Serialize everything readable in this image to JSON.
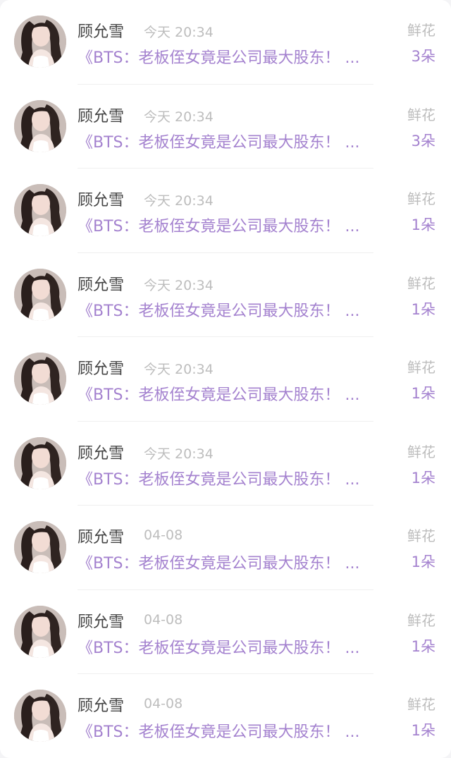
{
  "notifications": [
    {
      "name": "顾允雪",
      "time": "今天 20:34",
      "gift_label": "鲜花",
      "message": "《BTS：老板侄女竟是公司最大股东！ ...",
      "count": "3朵",
      "avatar_icon": "user-avatar-photo"
    },
    {
      "name": "顾允雪",
      "time": "今天 20:34",
      "gift_label": "鲜花",
      "message": "《BTS：老板侄女竟是公司最大股东！ ...",
      "count": "3朵",
      "avatar_icon": "user-avatar-photo"
    },
    {
      "name": "顾允雪",
      "time": "今天 20:34",
      "gift_label": "鲜花",
      "message": "《BTS：老板侄女竟是公司最大股东！ ...",
      "count": "1朵",
      "avatar_icon": "user-avatar-photo"
    },
    {
      "name": "顾允雪",
      "time": "今天 20:34",
      "gift_label": "鲜花",
      "message": "《BTS：老板侄女竟是公司最大股东！ ...",
      "count": "1朵",
      "avatar_icon": "user-avatar-photo"
    },
    {
      "name": "顾允雪",
      "time": "今天 20:34",
      "gift_label": "鲜花",
      "message": "《BTS：老板侄女竟是公司最大股东！ ...",
      "count": "1朵",
      "avatar_icon": "user-avatar-photo"
    },
    {
      "name": "顾允雪",
      "time": "今天 20:34",
      "gift_label": "鲜花",
      "message": "《BTS：老板侄女竟是公司最大股东！ ...",
      "count": "1朵",
      "avatar_icon": "user-avatar-photo"
    },
    {
      "name": "顾允雪",
      "time": "04-08",
      "gift_label": "鲜花",
      "message": "《BTS：老板侄女竟是公司最大股东！ ...",
      "count": "1朵",
      "avatar_icon": "user-avatar-photo"
    },
    {
      "name": "顾允雪",
      "time": "04-08",
      "gift_label": "鲜花",
      "message": "《BTS：老板侄女竟是公司最大股东！ ...",
      "count": "1朵",
      "avatar_icon": "user-avatar-photo"
    },
    {
      "name": "顾允雪",
      "time": "04-08",
      "gift_label": "鲜花",
      "message": "《BTS：老板侄女竟是公司最大股东！ ...",
      "count": "1朵",
      "avatar_icon": "user-avatar-photo"
    }
  ],
  "colors": {
    "accent_purple": "#a482cf",
    "name_text": "#444444",
    "muted_text": "#bdbdbd",
    "background": "#ffffff"
  }
}
